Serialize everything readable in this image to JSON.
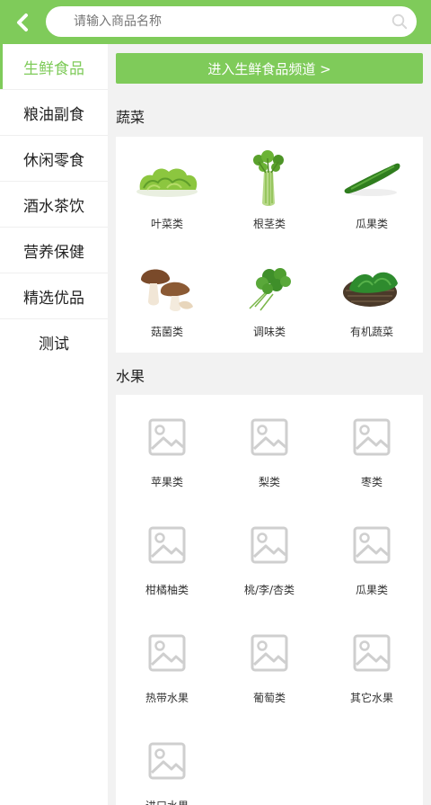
{
  "search": {
    "placeholder": "请输入商品名称"
  },
  "sidebar": {
    "items": [
      {
        "label": "生鲜食品"
      },
      {
        "label": "粮油副食"
      },
      {
        "label": "休闲零食"
      },
      {
        "label": "酒水茶饮"
      },
      {
        "label": "营养保健"
      },
      {
        "label": "精选优品"
      },
      {
        "label": "测试"
      }
    ],
    "active_index": 0
  },
  "main": {
    "banner_label": "进入生鲜食品频道 >",
    "sections": [
      {
        "title": "蔬菜",
        "items": [
          {
            "label": "叶菜类",
            "icon": "lettuce-image"
          },
          {
            "label": "根茎类",
            "icon": "celery-image"
          },
          {
            "label": "瓜果类",
            "icon": "cucumber-image"
          },
          {
            "label": "菇菌类",
            "icon": "mushroom-image"
          },
          {
            "label": "调味类",
            "icon": "cilantro-image"
          },
          {
            "label": "有机蔬菜",
            "icon": "spinach-basket-image"
          }
        ]
      },
      {
        "title": "水果",
        "items": [
          {
            "label": "苹果类",
            "icon": "image-placeholder-icon"
          },
          {
            "label": "梨类",
            "icon": "image-placeholder-icon"
          },
          {
            "label": "枣类",
            "icon": "image-placeholder-icon"
          },
          {
            "label": "柑橘柚类",
            "icon": "image-placeholder-icon"
          },
          {
            "label": "桃/李/杏类",
            "icon": "image-placeholder-icon"
          },
          {
            "label": "瓜果类",
            "icon": "image-placeholder-icon"
          },
          {
            "label": "热带水果",
            "icon": "image-placeholder-icon"
          },
          {
            "label": "葡萄类",
            "icon": "image-placeholder-icon"
          },
          {
            "label": "其它水果",
            "icon": "image-placeholder-icon"
          },
          {
            "label": "进口水果",
            "icon": "image-placeholder-icon"
          }
        ]
      }
    ]
  },
  "colors": {
    "accent": "#7fcb5a",
    "background": "#f2f2f2",
    "placeholder_gray": "#cfcfcf"
  }
}
